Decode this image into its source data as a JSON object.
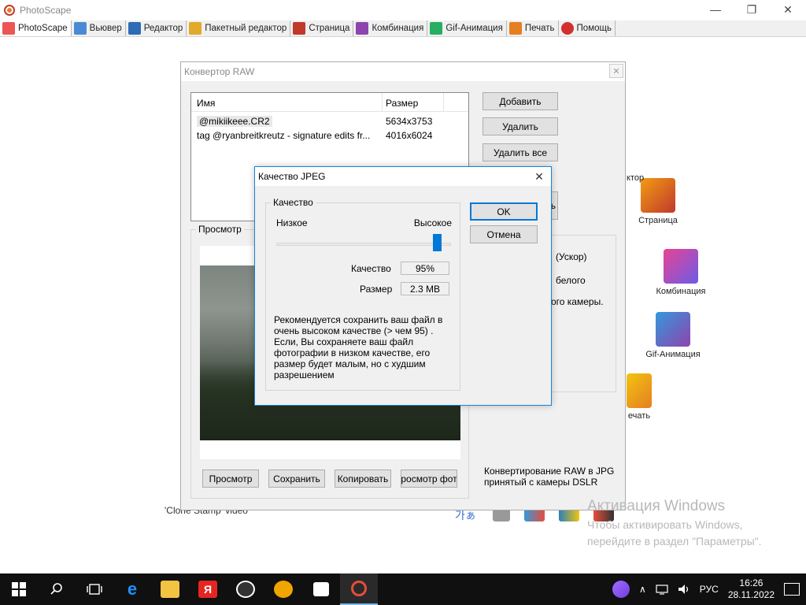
{
  "app": {
    "title": "PhotoScape",
    "controls": {
      "minimize": "—",
      "maximize": "❐",
      "close": "✕"
    }
  },
  "tabs": [
    {
      "label": "PhotoScape",
      "icon": "photoscape-icon",
      "color": "#e55"
    },
    {
      "label": "Вьювер",
      "icon": "viewer-icon",
      "color": "#4a8ad4"
    },
    {
      "label": "Редактор",
      "icon": "editor-icon",
      "color": "#2d6bb5"
    },
    {
      "label": "Пакетный редактор",
      "icon": "batch-editor-icon",
      "color": "#e2a92b"
    },
    {
      "label": "Страница",
      "icon": "page-icon",
      "color": "#c0392b"
    },
    {
      "label": "Комбинация",
      "icon": "combine-icon",
      "color": "#8e44ad"
    },
    {
      "label": "Gif-Анимация",
      "icon": "gif-icon",
      "color": "#27ae60"
    },
    {
      "label": "Печать",
      "icon": "print-icon",
      "color": "#e67e22"
    },
    {
      "label": "Помощь",
      "icon": "help-icon",
      "color": "#d32f2f"
    }
  ],
  "background_items": {
    "page_partial": "ктор",
    "page": "Страница",
    "combine": "Комбинация",
    "gif": "Gif-Анимация",
    "print_partial": "ечать",
    "footer": "'Clone Stamp' video"
  },
  "raw_converter": {
    "title": "Конвертор RAW",
    "close": "✕",
    "columns": {
      "name": "Имя",
      "size": "Размер"
    },
    "files": [
      {
        "name": "@mikiikeee.CR2",
        "size": "5634x3753"
      },
      {
        "name": "tag @ryanbreitkreutz - signature edits fr...",
        "size": "4016x6024"
      }
    ],
    "buttons": {
      "add": "Добавить",
      "delete": "Удалить",
      "delete_all": "Удалить все",
      "partial_button": "ь"
    },
    "preview_label": "Просмотр",
    "preview_buttons": {
      "preview": "Просмотр",
      "save": "Сохранить",
      "copy": "Копировать",
      "view_photo": "росмотр фот"
    },
    "options": {
      "opt1": "(Ускор)",
      "opt2": "белого",
      "opt3": "ого камеры."
    },
    "description": "Конвертирование RAW в JPG принятый с камеры DSLR"
  },
  "jpeg_dialog": {
    "title": "Качество JPEG",
    "close": "✕",
    "group_label": "Качество",
    "low": "Низкое",
    "high": "Высокое",
    "quality_label": "Качество",
    "quality_value": "95%",
    "quality_fraction": 0.95,
    "size_label": "Размер",
    "size_value": "2.3 MB",
    "description": "Рекомендуется сохранить ваш файл в очень высоком качестве (> чем 95) . Если, Вы сохраняете ваш файл фотографии в низком качестве, его размер будет малым, но с худшим разрешением",
    "ok": "OK",
    "cancel": "Отмена"
  },
  "watermark": {
    "title": "Активация Windows",
    "line1": "Чтобы активировать Windows,",
    "line2": "перейдите в раздел \"Параметры\"."
  },
  "taskbar": {
    "language": "РУС",
    "time": "16:26",
    "date": "28.11.2022"
  }
}
